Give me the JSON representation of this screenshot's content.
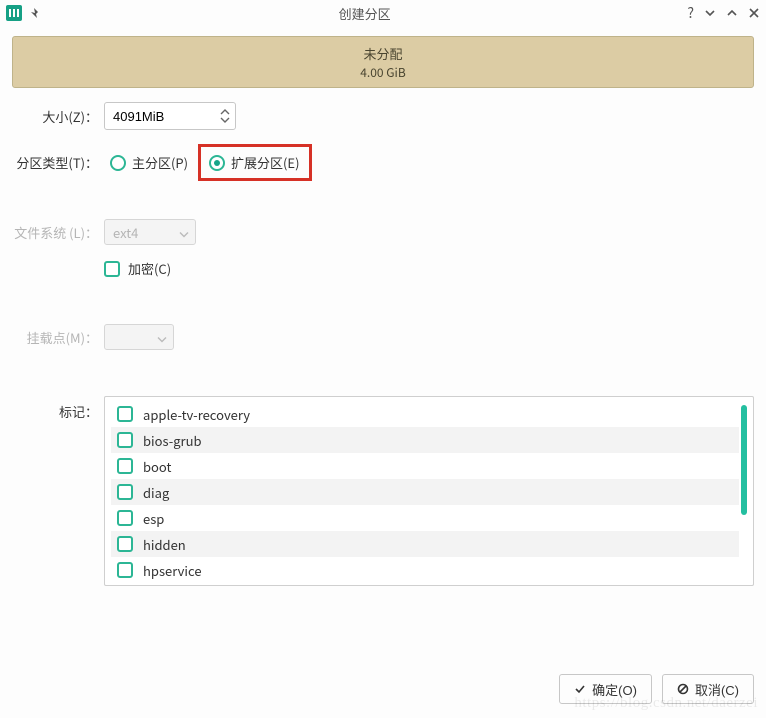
{
  "titlebar": {
    "title": "创建分区"
  },
  "unallocated": {
    "label": "未分配",
    "size": "4.00 GiB"
  },
  "form": {
    "size_label": "大小(Z)：",
    "size_value": "4091MiB",
    "type_label": "分区类型(T)：",
    "type_primary": "主分区(P)",
    "type_extended": "扩展分区(E)",
    "fs_label": "文件系统 (L)：",
    "fs_value": "ext4",
    "encrypt_label": "加密(C)",
    "mount_label": "挂载点(M)：",
    "mount_value": "",
    "flags_label": "标记：",
    "flags": [
      "apple-tv-recovery",
      "bios-grub",
      "boot",
      "diag",
      "esp",
      "hidden",
      "hpservice"
    ]
  },
  "footer": {
    "ok": "确定(O)",
    "cancel": "取消(C)"
  },
  "watermark": "https://blog.csdn.net/daerzei"
}
